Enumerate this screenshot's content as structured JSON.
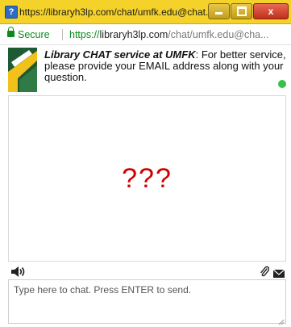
{
  "window": {
    "title": "https://libraryh3lp.com/chat/umfk.edu@chat...",
    "app_icon_glyph": "?",
    "controls": [
      "minimize-icon",
      "maximize-icon",
      "close-icon"
    ],
    "close_glyph": "x"
  },
  "address_bar": {
    "secure_label": "Secure",
    "url_scheme": "https://",
    "url_host": "libraryh3lp.com",
    "url_path": "/chat/umfk.edu@cha..."
  },
  "header": {
    "service_name": "Library CHAT service at UMFK",
    "message": ": For better service, please provide your EMAIL address along with your question.",
    "status_color": "#35c24a"
  },
  "conversation": {
    "content": "???",
    "content_color": "#cc0000"
  },
  "toolbar": {
    "icons": [
      "speaker-icon",
      "paperclip-icon",
      "envelope-icon"
    ]
  },
  "input": {
    "placeholder": "Type here to chat. Press ENTER to send.",
    "value": ""
  },
  "colors": {
    "titlebar": "#f4d22a",
    "secure_green": "#0a8a1f",
    "logo_green": "#1e5a34",
    "logo_gold": "#f2c21b"
  }
}
